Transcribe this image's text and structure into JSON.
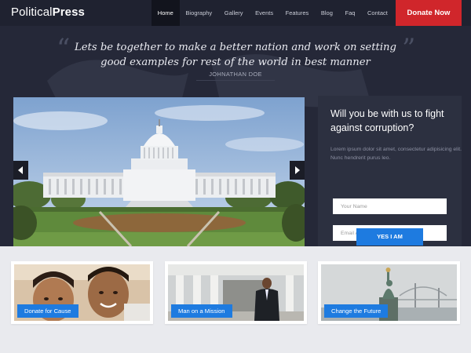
{
  "header": {
    "logo_light": "Political",
    "logo_bold": "Press",
    "nav": [
      "Home",
      "Biography",
      "Gallery",
      "Events",
      "Features",
      "Blog",
      "Faq",
      "Contact"
    ],
    "active_nav": "Home",
    "donate_label": "Donate Now"
  },
  "quote": {
    "open_mark": "“",
    "close_mark": "”",
    "text": "Lets be together to make a better nation and work on setting good examples for rest of the world in best manner",
    "author": "JOHNATHAN DOE"
  },
  "slider": {
    "prev_icon": "chevron-left-icon",
    "next_icon": "chevron-right-icon"
  },
  "form": {
    "title": "Will you be with us to fight against corruption?",
    "description": "Lorem ipsum dolor sit amet, consectetur adipisicing elit. Nunc hendrerit purus leo.",
    "name_placeholder": "Your Name",
    "email_placeholder": "Email Address",
    "submit_label": "YES I AM"
  },
  "cards": [
    {
      "label": "Donate for Cause"
    },
    {
      "label": "Man on a Mission"
    },
    {
      "label": "Change the Future"
    }
  ],
  "colors": {
    "header_bg": "#1f2230",
    "hero_bg": "#252838",
    "donate_red": "#d0262b",
    "accent_blue": "#1e7be0"
  }
}
